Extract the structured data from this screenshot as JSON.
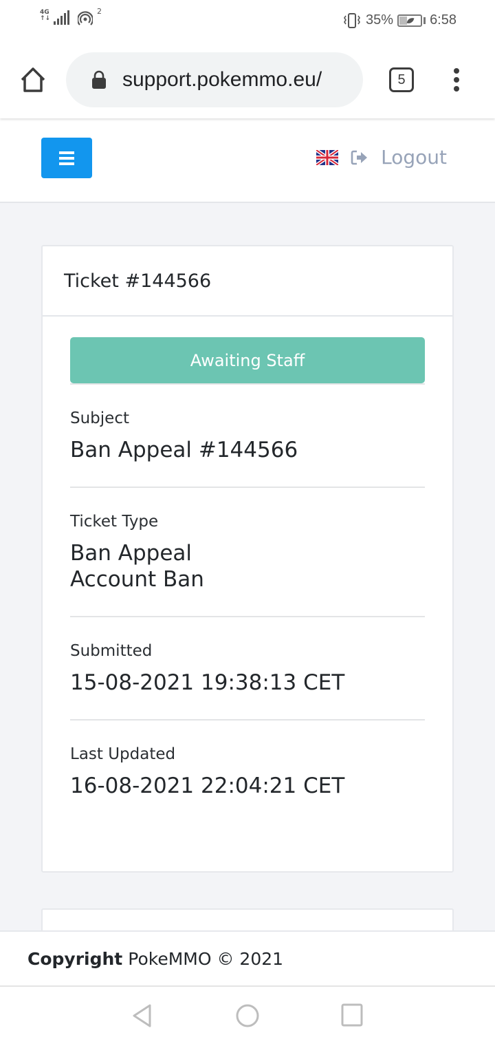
{
  "status_bar": {
    "network": "4G",
    "hotspot_count": "2",
    "battery_percent": "35%",
    "time": "6:58"
  },
  "browser": {
    "url": "support.pokemmo.eu/",
    "tab_count": "5"
  },
  "nav": {
    "language": "English (UK)",
    "logout_label": "Logout",
    "accent_color": "#1296ee"
  },
  "ticket": {
    "title": "Ticket #144566",
    "status": "Awaiting Staff",
    "status_color": "#6cc5b2",
    "fields": [
      {
        "label": "Subject",
        "value": "Ban Appeal #144566"
      },
      {
        "label": "Ticket Type",
        "value_lines": [
          "Ban Appeal",
          "Account Ban"
        ]
      },
      {
        "label": "Submitted",
        "value": "15-08-2021 19:38:13 CET"
      },
      {
        "label": "Last Updated",
        "value": "16-08-2021 22:04:21 CET"
      }
    ]
  },
  "footer": {
    "copyright_bold": "Copyright",
    "copyright_text": "PokeMMO © 2021"
  }
}
